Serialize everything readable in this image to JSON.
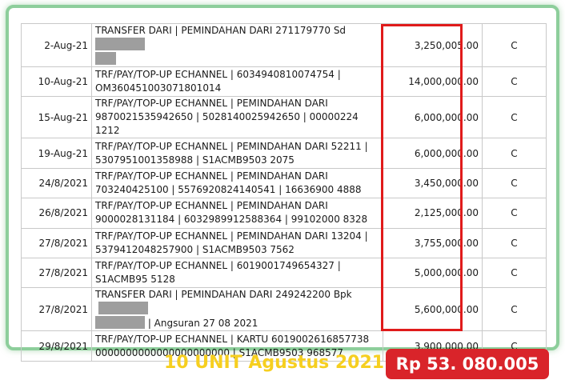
{
  "transactions": [
    {
      "date": "2-Aug-21",
      "desc_1": "TRANSFER DARI | PEMINDAHAN DARI 271179770 Sd",
      "desc_2": "",
      "amount": "3,250,005.00",
      "dc": "C"
    },
    {
      "date": "10-Aug-21",
      "desc_1": "TRF/PAY/TOP-UP ECHANNEL | 6034940810074754 |",
      "desc_2": "OM360451003071801014",
      "amount": "14,000,000.00",
      "dc": "C"
    },
    {
      "date": "15-Aug-21",
      "desc_1": "TRF/PAY/TOP-UP ECHANNEL | PEMINDAHAN DARI",
      "desc_2": "9870021535942650 | 5028140025942650 | 00000224 1212",
      "amount": "6,000,000.00",
      "dc": "C"
    },
    {
      "date": "19-Aug-21",
      "desc_1": "TRF/PAY/TOP-UP ECHANNEL | PEMINDAHAN DARI 52211 |",
      "desc_2": "5307951001358988 | S1ACMB9503 2075",
      "amount": "6,000,000.00",
      "dc": "C"
    },
    {
      "date": "24/8/2021",
      "desc_1": "TRF/PAY/TOP-UP ECHANNEL | PEMINDAHAN DARI",
      "desc_2": "703240425100 | 5576920824140541 | 16636900 4888",
      "amount": "3,450,000.00",
      "dc": "C"
    },
    {
      "date": "26/8/2021",
      "desc_1": "TRF/PAY/TOP-UP ECHANNEL | PEMINDAHAN DARI",
      "desc_2": "9000028131184 | 6032989912588364 | 99102000 8328",
      "amount": "2,125,000.00",
      "dc": "C"
    },
    {
      "date": "27/8/2021",
      "desc_1": "TRF/PAY/TOP-UP ECHANNEL | PEMINDAHAN DARI 13204 |",
      "desc_2": "5379412048257900 | S1ACMB9503 7562",
      "amount": "3,755,000.00",
      "dc": "C"
    },
    {
      "date": "27/8/2021",
      "desc_1": "TRF/PAY/TOP-UP ECHANNEL | 6019001749654327 |",
      "desc_2": "S1ACMB95 5128",
      "amount": "5,000,000.00",
      "dc": "C"
    },
    {
      "date": "27/8/2021",
      "desc_1": "TRANSFER DARI | PEMINDAHAN DARI 249242200 Bpk",
      "desc_2": " | Angsuran 27 08 2021",
      "amount": "5,600,000.00",
      "dc": "C"
    },
    {
      "date": "29/8/2021",
      "desc_1": "TRF/PAY/TOP-UP ECHANNEL | KARTU 6019002616857738",
      "desc_2": "0000000000000000000000 | S1ACMB9503 968577",
      "amount": "3,900,000.00",
      "dc": "C"
    }
  ],
  "footer": {
    "caption": "10 UNIT Agustus 2021",
    "total": "Rp 53. 080.005"
  },
  "colors": {
    "frame_border": "#8dce9b",
    "highlight": "#e01b1b",
    "caption": "#f6cf20",
    "badge": "#d9242a"
  }
}
